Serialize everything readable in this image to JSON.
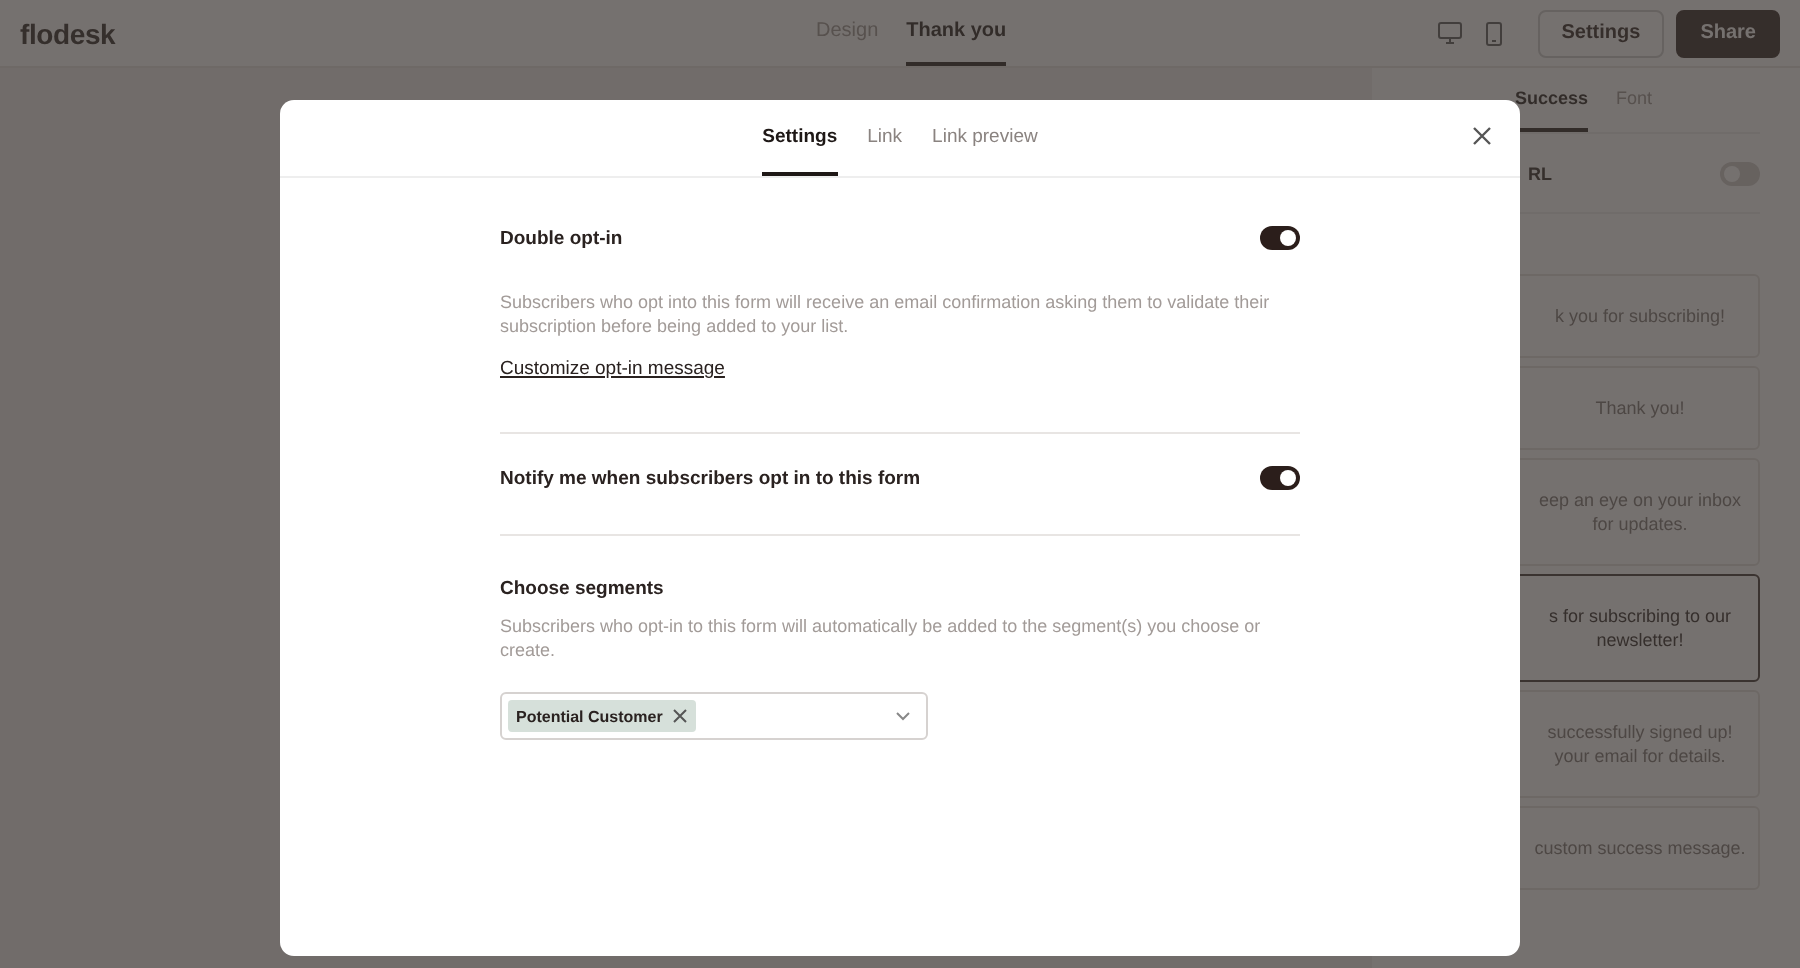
{
  "logo": "flodesk",
  "top_tabs": [
    {
      "label": "Design",
      "selected": false
    },
    {
      "label": "Thank you",
      "selected": true
    }
  ],
  "buttons": [
    {
      "label": "Settings",
      "kind": "secondary"
    },
    {
      "label": "Share",
      "kind": "primary"
    }
  ],
  "panel": {
    "tabs": [
      {
        "label": "Success",
        "selected": true
      },
      {
        "label": "Font",
        "selected": false
      }
    ],
    "url_setting": {
      "label": "RL",
      "on": false
    },
    "messages": [
      {
        "lines": [
          "k you for subscribing!"
        ],
        "selected": false
      },
      {
        "lines": [
          "Thank you!"
        ],
        "selected": false
      },
      {
        "lines": [
          "eep an eye on your inbox",
          "for updates."
        ],
        "selected": false
      },
      {
        "lines": [
          "s for subscribing to our",
          "newsletter!"
        ],
        "selected": true
      },
      {
        "lines": [
          "successfully signed up!",
          "your email for details."
        ],
        "selected": false
      },
      {
        "lines": [
          "custom success message."
        ],
        "selected": false
      }
    ]
  },
  "modal": {
    "tabs": [
      {
        "label": "Settings",
        "selected": true
      },
      {
        "label": "Link",
        "selected": false
      },
      {
        "label": "Link preview",
        "selected": false
      }
    ],
    "sections": [
      {
        "kind": "toggle",
        "title": "Double opt-in",
        "on": true,
        "description": "Subscribers who opt into this form will receive an email confirmation asking them to validate their subscription before being added to your list.",
        "link": "Customize opt-in message"
      },
      {
        "kind": "toggle",
        "title": "Notify me when subscribers opt in to this form",
        "on": true
      },
      {
        "kind": "segments",
        "title": "Choose segments",
        "description": "Subscribers who opt-in to this form will automatically be added to the segment(s) you choose or create.",
        "tags": [
          "Potential Customer"
        ]
      }
    ]
  }
}
